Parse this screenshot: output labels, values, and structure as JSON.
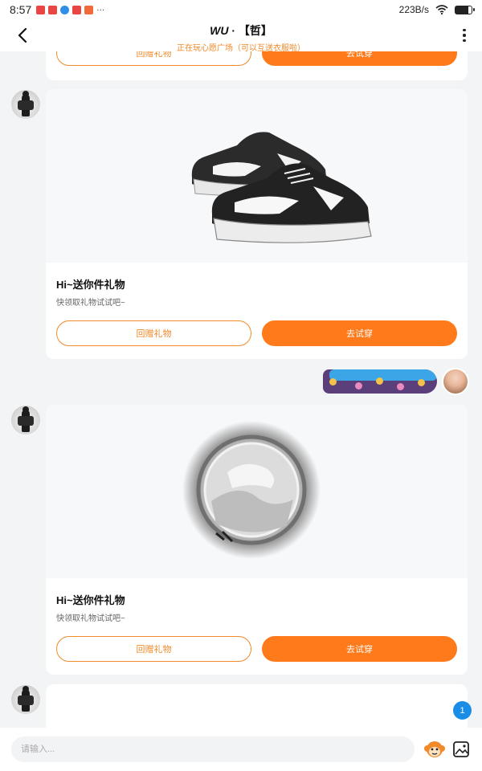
{
  "status_bar": {
    "time": "8:57",
    "network_speed": "223B/s",
    "battery_level": 0.8,
    "app_icons": [
      "notification-icon-red",
      "notification-icon-red",
      "notification-icon-blue",
      "notification-icon-red",
      "notification-icon-orange"
    ],
    "more": "···"
  },
  "header": {
    "title_prefix": "WU",
    "title_sep": " · ",
    "title_suffix": "【哲】",
    "subtitle": "正在玩心愿广场（可以互送衣服啦）"
  },
  "messages": [
    {
      "type": "gift_card_partial",
      "return_label": "回赠礼物",
      "try_label": "去试穿"
    },
    {
      "type": "gift_card",
      "image": "sneakers",
      "title": "Hi~送你件礼物",
      "subtitle": "快领取礼物试试吧~",
      "return_label": "回赠礼物",
      "try_label": "去试穿"
    },
    {
      "type": "sticker",
      "sender": "me"
    },
    {
      "type": "gift_card",
      "image": "round-frame",
      "title": "Hi~送你件礼物",
      "subtitle": "快领取礼物试试吧~",
      "return_label": "回赠礼物",
      "try_label": "去试穿"
    }
  ],
  "unread_badge": "1",
  "input": {
    "placeholder": "请输入..."
  },
  "colors": {
    "accent": "#ff7a1a",
    "accent_outline": "#f08a2a",
    "badge": "#1a8ee6",
    "background": "#f3f4f6"
  }
}
